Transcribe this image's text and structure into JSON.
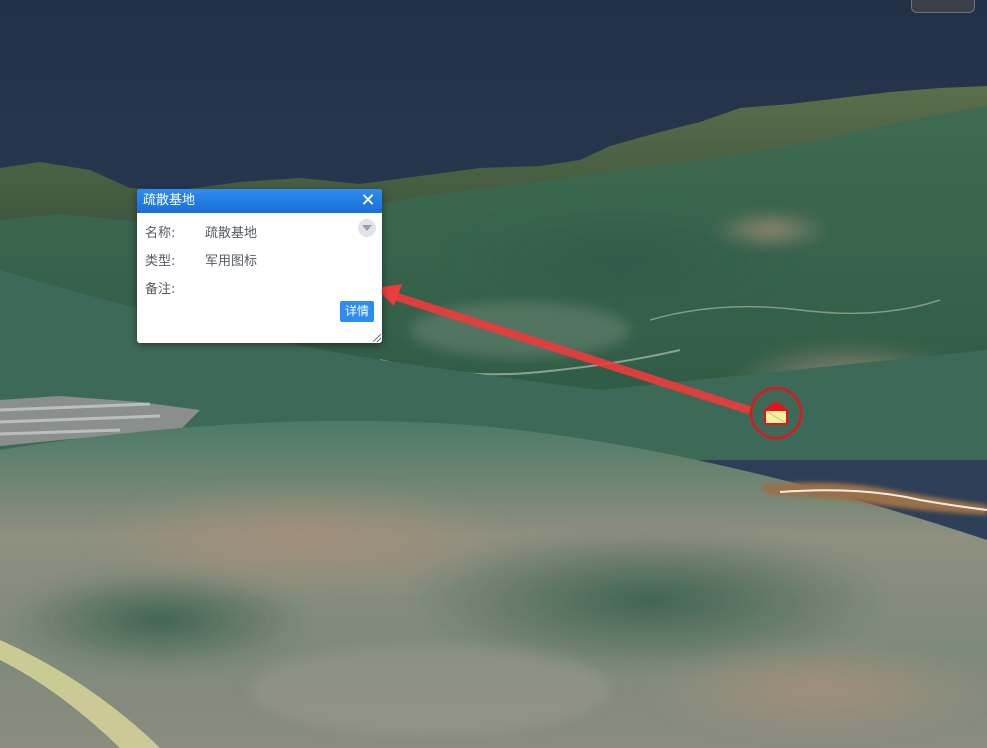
{
  "popup": {
    "title": "疏散基地",
    "close_glyph": "✕",
    "fields": {
      "name_label": "名称:",
      "name_value": "疏散基地",
      "type_label": "类型:",
      "type_value": "军用图标",
      "note_label": "备注:",
      "note_value": ""
    },
    "detail_button": "详情"
  },
  "marker": {
    "icon": "house-icon",
    "ring_color": "#e0151b",
    "roof_color": "#e0151b",
    "body_color": "#f4f0a0"
  },
  "leader_arrow": {
    "color": "#ee3b3b"
  },
  "colors": {
    "sky": "#2a3a55",
    "popup_header": "#1f79e0",
    "detail_button": "#2d8cf0"
  }
}
